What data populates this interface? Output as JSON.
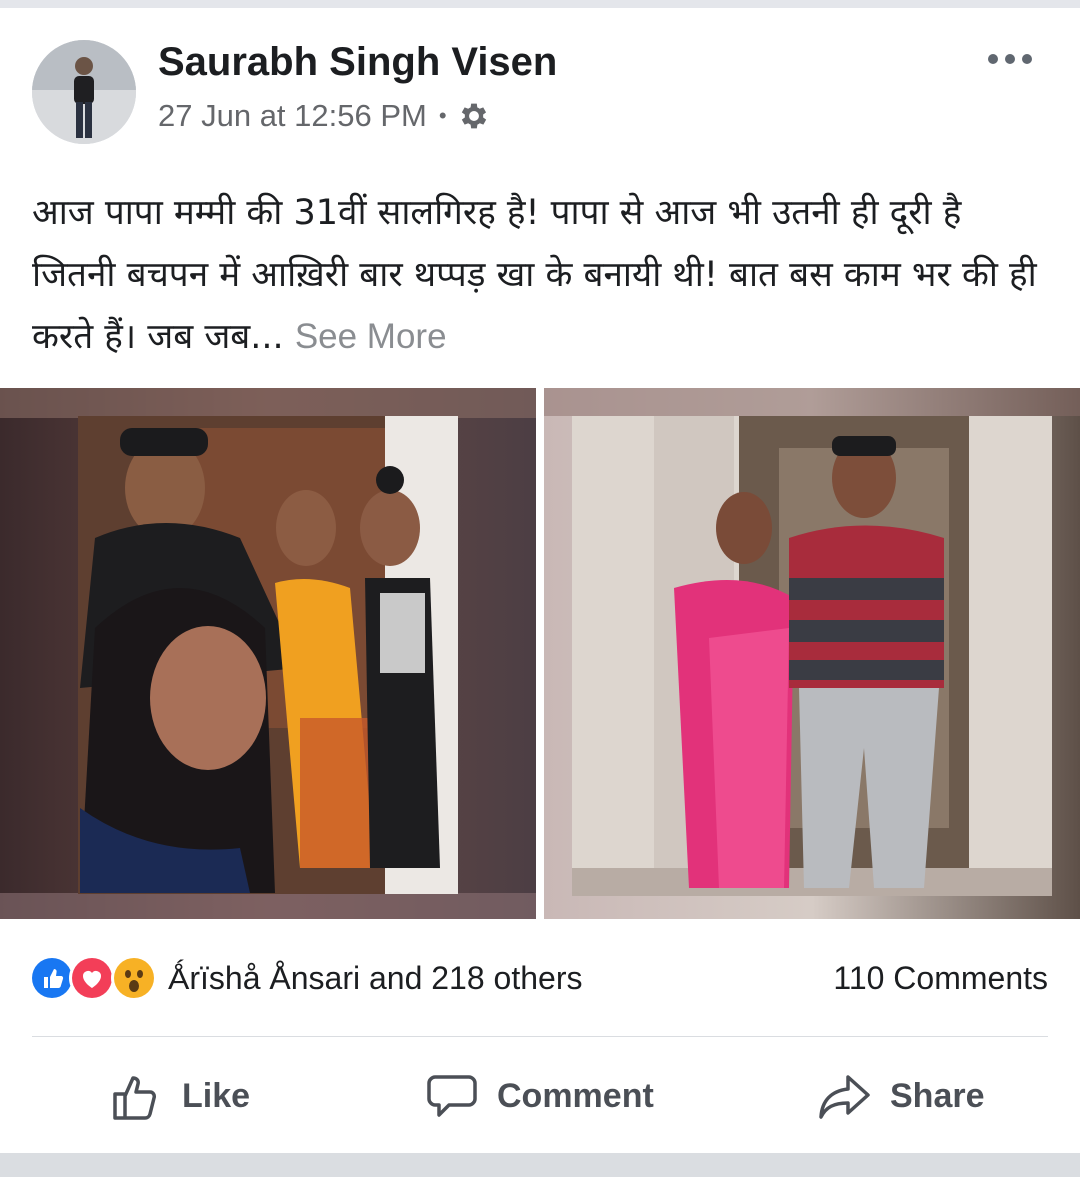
{
  "post": {
    "author": "Saurabh Singh Visen",
    "timestamp": "27 Jun at 12:56 PM",
    "separator": "•",
    "privacy_icon": "gear-icon",
    "more_icon": "more-options-icon",
    "text": "आज पापा मम्मी की 31वीं सालगिरह है! पापा से आज भी उतनी ही दूरी है जितनी बचपन में आख़िरी बार थप्पड़ खा के बनायी थी! बात बस काम भर की ही करते हैं। जब जब...",
    "see_more": "See More",
    "photos": [
      "family-selfie-photo",
      "parents-photo"
    ]
  },
  "reactions": {
    "icons": [
      "like-reaction-icon",
      "love-reaction-icon",
      "wow-reaction-icon"
    ],
    "summary": "Ǻrïshå Ånsari and 218 others",
    "comments": "110 Comments"
  },
  "actions": {
    "like": "Like",
    "comment": "Comment",
    "share": "Share"
  },
  "colors": {
    "like_blue": "#1877f2",
    "love_red": "#f33e58",
    "wow_yellow": "#f7b125",
    "secondary_text": "#65676b"
  }
}
